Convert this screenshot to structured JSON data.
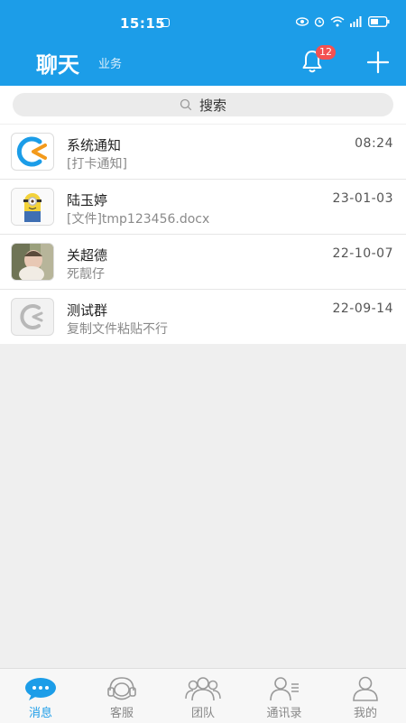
{
  "status_bar": {
    "time": "15:15"
  },
  "header": {
    "title": "聊天",
    "subtitle": "业务",
    "notification_count": "12"
  },
  "search": {
    "label": "搜索"
  },
  "conversations": [
    {
      "name": "系统通知",
      "preview": "[打卡通知]",
      "time": "08:24"
    },
    {
      "name": "陆玉婷",
      "preview": "[文件]tmp123456.docx",
      "time": "23-01-03"
    },
    {
      "name": "关超德",
      "preview": "死靓仔",
      "time": "22-10-07"
    },
    {
      "name": "测试群",
      "preview": "复制文件粘贴不行",
      "time": "22-09-14"
    }
  ],
  "tabs": [
    {
      "label": "消息",
      "icon": "chat-bubble-icon",
      "active": true
    },
    {
      "label": "客服",
      "icon": "headset-icon",
      "active": false
    },
    {
      "label": "团队",
      "icon": "team-icon",
      "active": false
    },
    {
      "label": "通讯录",
      "icon": "contacts-icon",
      "active": false
    },
    {
      "label": "我的",
      "icon": "profile-icon",
      "active": false
    }
  ],
  "colors": {
    "brand": "#1c9de8",
    "badge": "#f35151",
    "accent_orange": "#f39a1b"
  }
}
